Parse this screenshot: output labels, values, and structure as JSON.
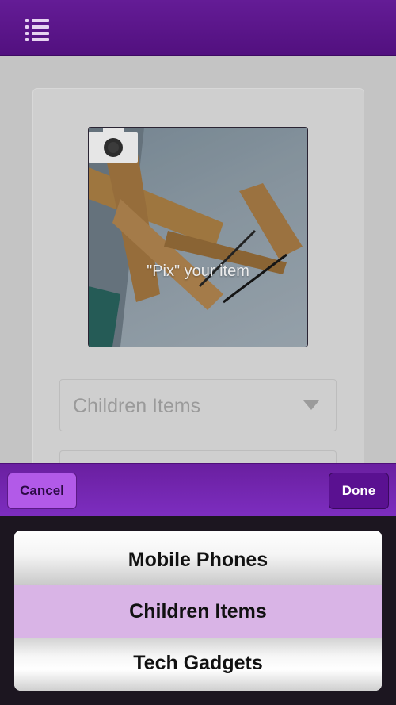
{
  "header": {
    "menu_icon": "list-menu-icon"
  },
  "form": {
    "photo": {
      "icon": "camera-icon",
      "label": "\"Pix\" your item"
    },
    "category_select": {
      "value": "Children Items",
      "icon": "caret-down-icon"
    }
  },
  "action_bar": {
    "cancel_label": "Cancel",
    "done_label": "Done"
  },
  "picker": {
    "options": [
      {
        "label": "Mobile Phones"
      },
      {
        "label": "Children Items"
      },
      {
        "label": "Tech Gadgets"
      }
    ],
    "selected": "Children Items"
  },
  "colors": {
    "header": "#5a1389",
    "accent": "#7a2bb8",
    "cancel_button": "#b25ae8",
    "done_button": "#5a1191",
    "selected_option": "#d9b4e6"
  }
}
